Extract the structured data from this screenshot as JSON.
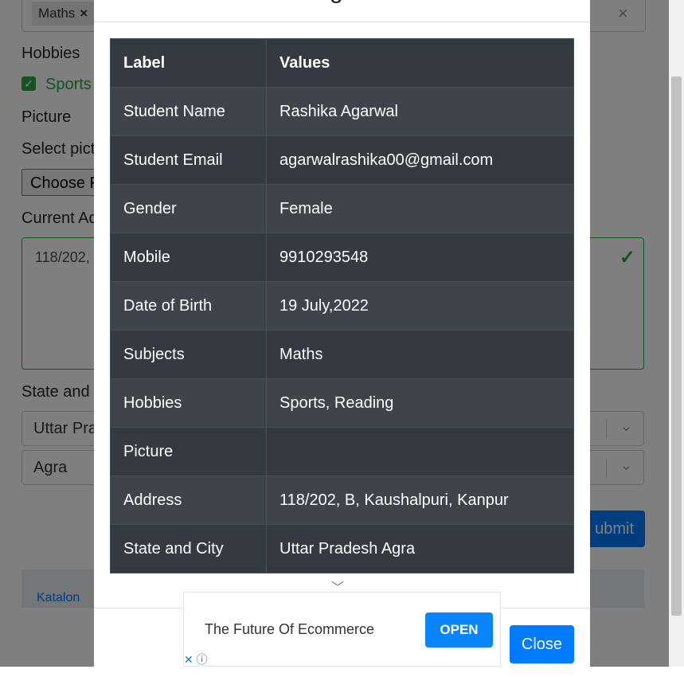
{
  "background_form": {
    "subject_tag": "Maths",
    "subject_tag_remove": "×",
    "clear_icon": "×",
    "hobbies_label": "Hobbies",
    "hobby_checked_label": "Sports",
    "picture_label": "Picture",
    "select_picture_label": "Select pict",
    "choose_file_label": "Choose F",
    "current_address_label": "Current Ad",
    "address_value": "118/202,",
    "state_city_label": "State and C",
    "state_value": "Uttar Pra",
    "city_value": "Agra",
    "submit_label": "ubmit",
    "banner_alt": "Katalon"
  },
  "modal": {
    "title_fragment": "g",
    "table": {
      "headers": [
        "Label",
        "Values"
      ],
      "rows": [
        {
          "label": "Student Name",
          "value": "Rashika Agarwal"
        },
        {
          "label": "Student Email",
          "value": "agarwalrashika00@gmail.com"
        },
        {
          "label": "Gender",
          "value": "Female"
        },
        {
          "label": "Mobile",
          "value": "9910293548"
        },
        {
          "label": "Date of Birth",
          "value": "19 July,2022"
        },
        {
          "label": "Subjects",
          "value": "Maths"
        },
        {
          "label": "Hobbies",
          "value": "Sports, Reading"
        },
        {
          "label": "Picture",
          "value": ""
        },
        {
          "label": "Address",
          "value": "118/202, B, Kaushalpuri, Kanpur"
        },
        {
          "label": "State and City",
          "value": "Uttar Pradesh Agra"
        }
      ]
    },
    "close_label": "Close"
  },
  "ad": {
    "text": "The Future Of Ecommerce",
    "open_label": "OPEN",
    "close_icon": "✕",
    "info_icon": "ⓘ"
  },
  "colors": {
    "primary": "#007bff",
    "success": "#28a745",
    "table_dark": "#343a40"
  }
}
